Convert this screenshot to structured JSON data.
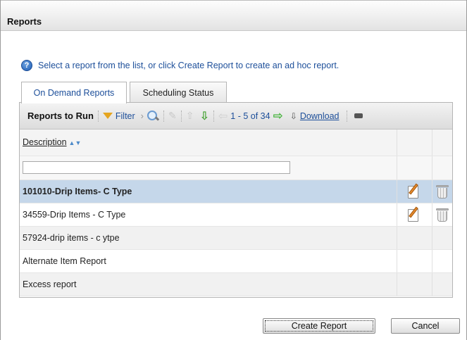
{
  "window": {
    "title": "Reports"
  },
  "info": {
    "text": "Select a report from the list, or click Create Report to create an ad hoc report."
  },
  "tabs": [
    {
      "label": "On Demand Reports",
      "active": true
    },
    {
      "label": "Scheduling Status",
      "active": false
    }
  ],
  "toolbar": {
    "title": "Reports to Run",
    "filter_label": "Filter",
    "pager_text": "1 - 5 of 34",
    "download_label": "Download"
  },
  "grid": {
    "column_header": "Description",
    "filter_value": "",
    "rows": [
      {
        "description": "101010-Drip Items- C Type",
        "selected": true,
        "has_actions": true
      },
      {
        "description": "34559-Drip Items - C Type",
        "selected": false,
        "has_actions": true
      },
      {
        "description": "57924-drip items - c ytpe",
        "selected": false,
        "has_actions": false
      },
      {
        "description": "Alternate Item Report",
        "selected": false,
        "has_actions": false
      },
      {
        "description": "Excess report",
        "selected": false,
        "has_actions": false
      }
    ]
  },
  "buttons": {
    "create": "Create Report",
    "cancel": "Cancel"
  },
  "colors": {
    "accent": "#1d4f9a",
    "selected_row": "#c5d7ea",
    "filter_icon": "#e5a520",
    "nav_green": "#43b33a"
  },
  "icons": [
    "help-icon",
    "filter-icon",
    "search-icon",
    "edit-icon",
    "move-up-icon",
    "move-down-icon",
    "prev-page-icon",
    "next-page-icon",
    "download-icon",
    "collapse-icon",
    "trash-icon"
  ]
}
